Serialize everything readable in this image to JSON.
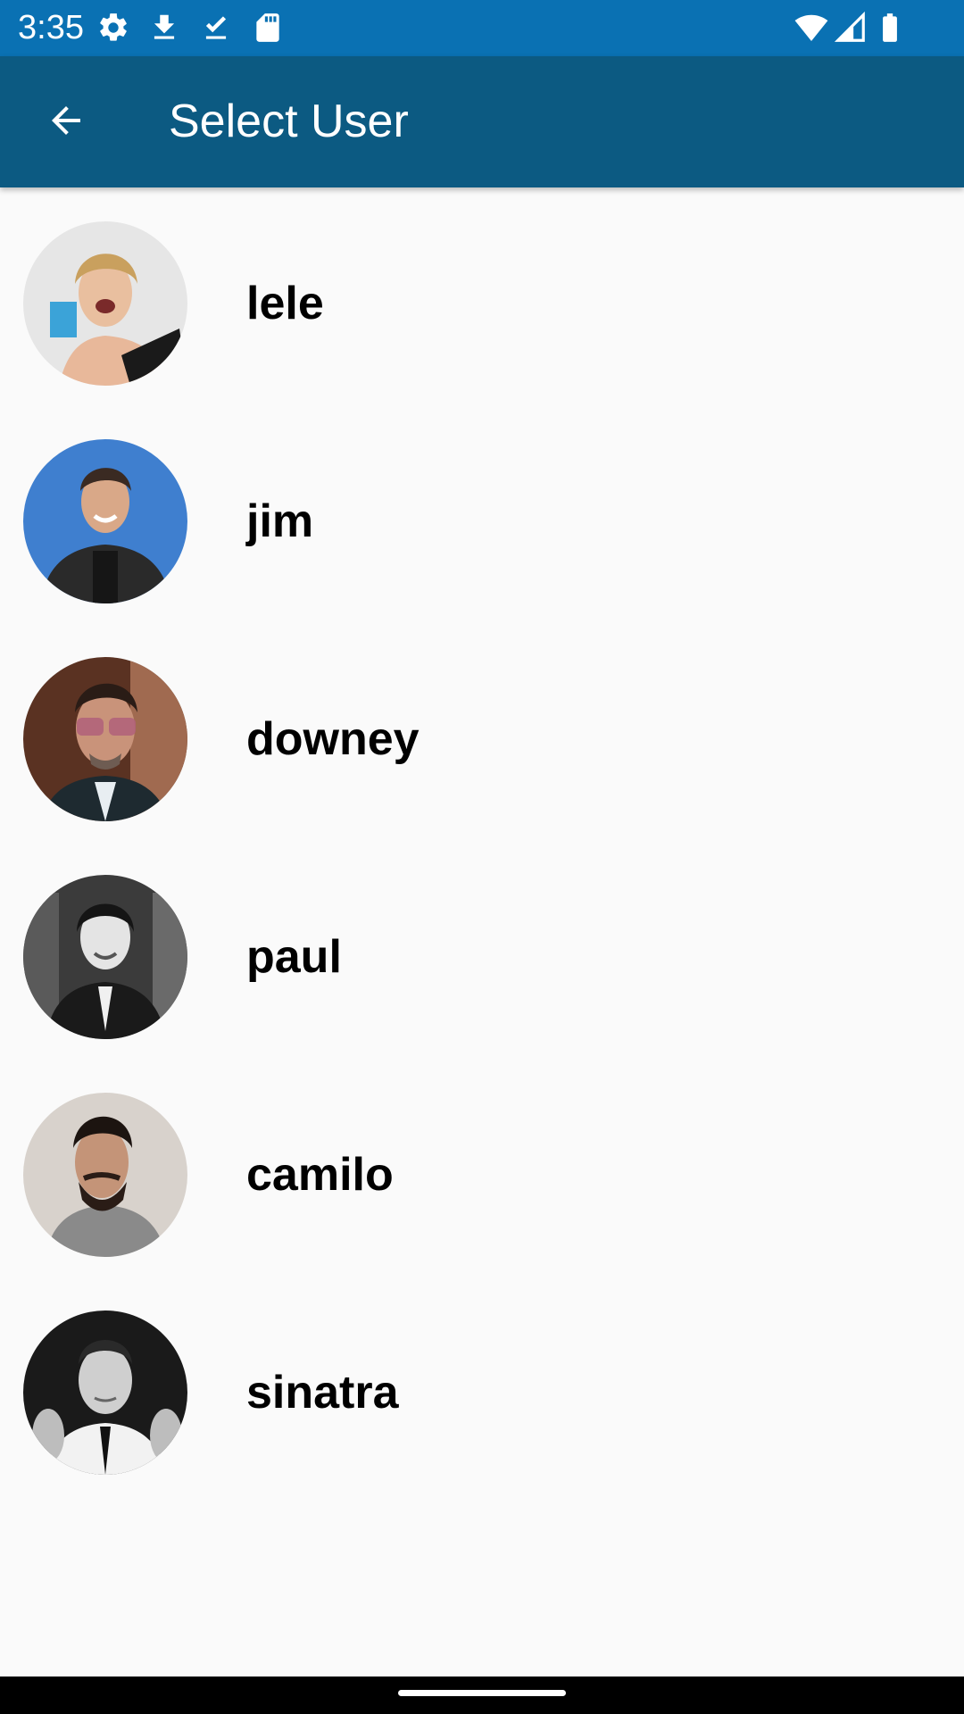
{
  "status_bar": {
    "time": "3:35",
    "icons_left": [
      "settings-icon",
      "download-icon",
      "download-done-icon",
      "sd-card-icon"
    ],
    "icons_right": [
      "wifi-icon",
      "cell-signal-icon",
      "battery-icon"
    ]
  },
  "app_bar": {
    "title": "Select User",
    "back_icon": "arrow-back-icon",
    "color": "#0c5a82"
  },
  "status_color": "#0a71b3",
  "users": [
    {
      "name": "lele"
    },
    {
      "name": "jim"
    },
    {
      "name": "downey"
    },
    {
      "name": "paul"
    },
    {
      "name": "camilo"
    },
    {
      "name": "sinatra"
    }
  ]
}
